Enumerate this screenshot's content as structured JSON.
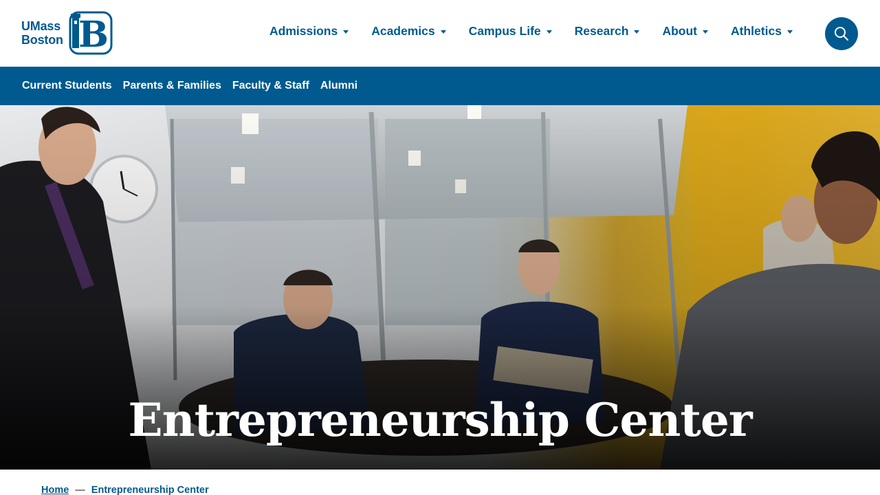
{
  "brand": {
    "logo_line1": "UMass",
    "logo_line2": "Boston",
    "logo_letter": "B",
    "color_primary": "#005a8f"
  },
  "main_nav": {
    "items": [
      {
        "label": "Admissions"
      },
      {
        "label": "Academics"
      },
      {
        "label": "Campus Life"
      },
      {
        "label": "Research"
      },
      {
        "label": "About"
      },
      {
        "label": "Athletics"
      }
    ],
    "search_icon": "search-icon"
  },
  "audience_nav": {
    "items": [
      {
        "label": "Current Students"
      },
      {
        "label": "Parents & Families"
      },
      {
        "label": "Faculty & Staff"
      },
      {
        "label": "Alumni"
      }
    ]
  },
  "hero": {
    "title": "Entrepreneurship Center"
  },
  "breadcrumb": {
    "home": "Home",
    "separator": "—",
    "current": "Entrepreneurship Center"
  }
}
